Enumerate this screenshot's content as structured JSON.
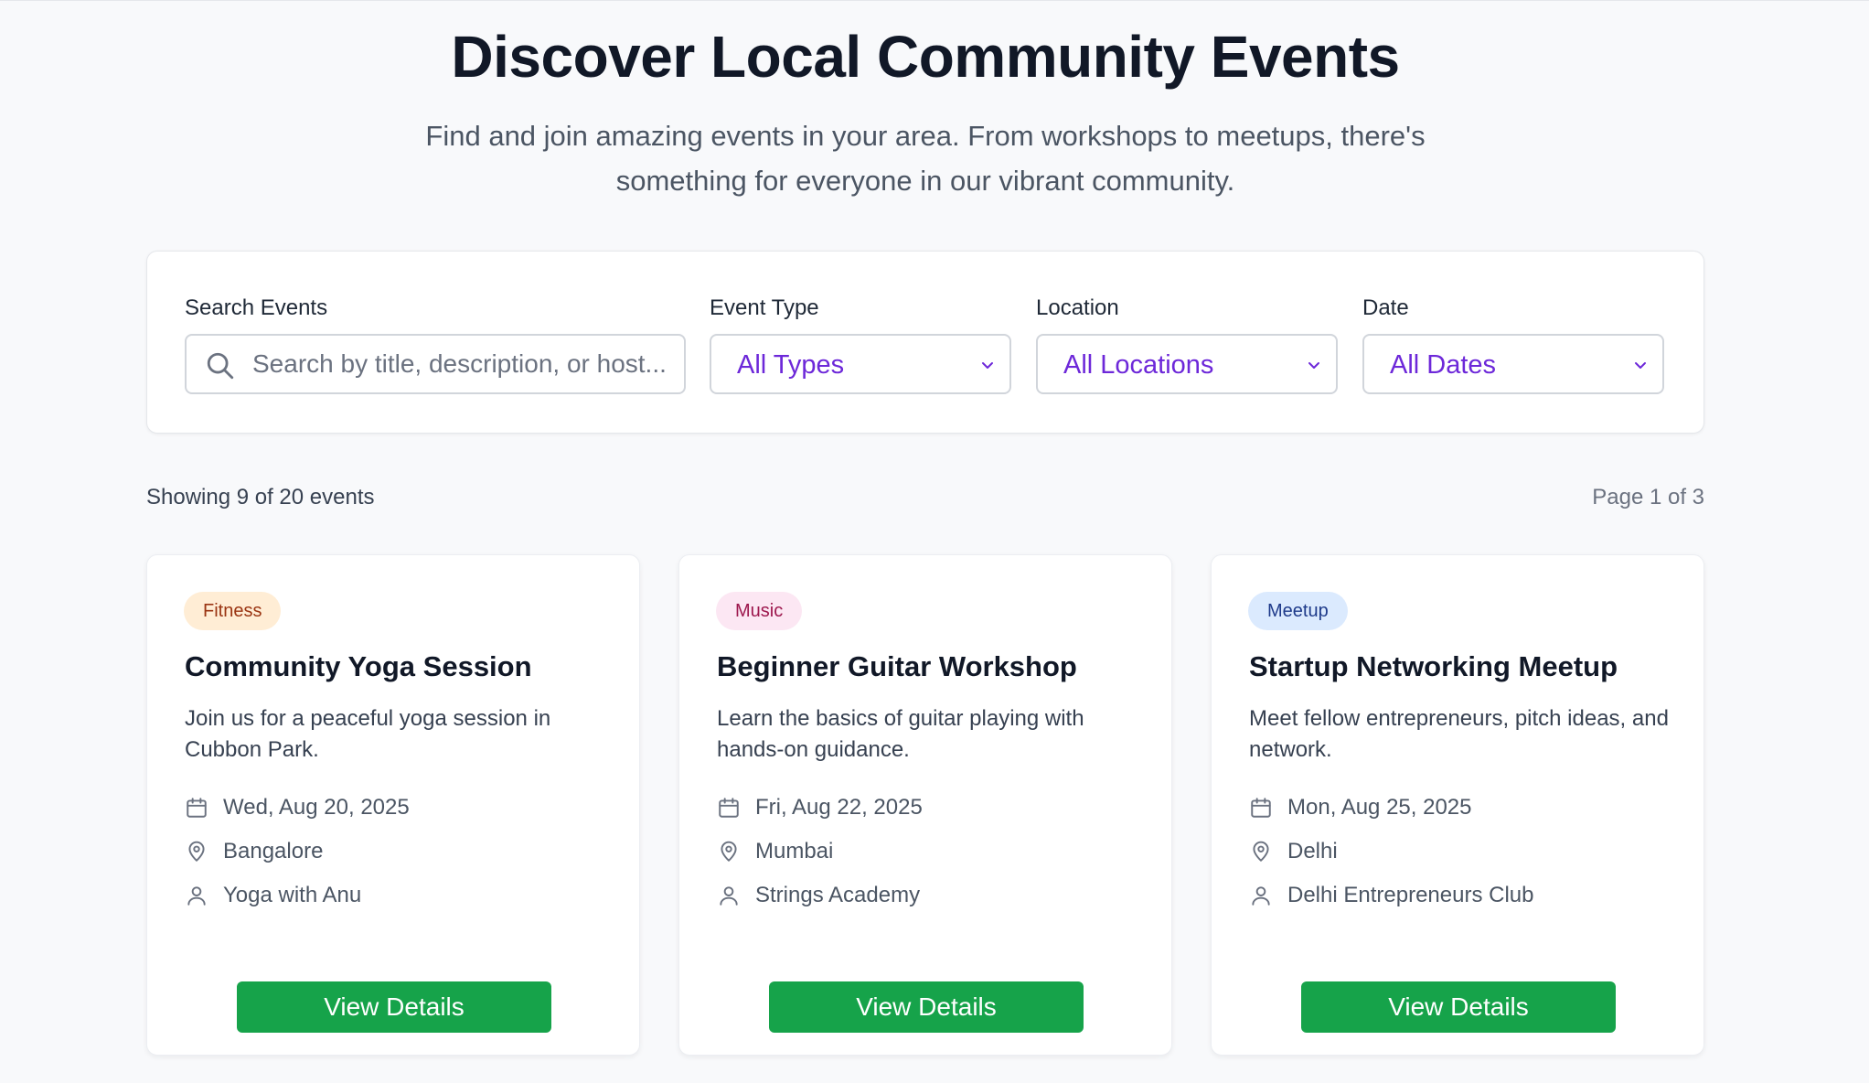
{
  "header": {
    "title": "Discover Local Community Events",
    "subtitle": "Find and join amazing events in your area. From workshops to meetups, there's something for everyone in our vibrant community."
  },
  "filters": {
    "search_label": "Search Events",
    "search_placeholder": "Search by title, description, or host...",
    "type_label": "Event Type",
    "type_value": "All Types",
    "location_label": "Location",
    "location_value": "All Locations",
    "date_label": "Date",
    "date_value": "All Dates"
  },
  "results": {
    "showing": "Showing 9 of 20 events",
    "page": "Page 1 of 3"
  },
  "colors": {
    "button": "#16a34a",
    "select_text": "#6d28d9"
  },
  "events": [
    {
      "category": "Fitness",
      "title": "Community Yoga Session",
      "description": "Join us for a peaceful yoga session in Cubbon Park.",
      "date": "Wed, Aug 20, 2025",
      "location": "Bangalore",
      "host": "Yoga with Anu",
      "button": "View Details"
    },
    {
      "category": "Music",
      "title": "Beginner Guitar Workshop",
      "description": "Learn the basics of guitar playing with hands-on guidance.",
      "date": "Fri, Aug 22, 2025",
      "location": "Mumbai",
      "host": "Strings Academy",
      "button": "View Details"
    },
    {
      "category": "Meetup",
      "title": "Startup Networking Meetup",
      "description": "Meet fellow entrepreneurs, pitch ideas, and network.",
      "date": "Mon, Aug 25, 2025",
      "location": "Delhi",
      "host": "Delhi Entrepreneurs Club",
      "button": "View Details"
    }
  ]
}
